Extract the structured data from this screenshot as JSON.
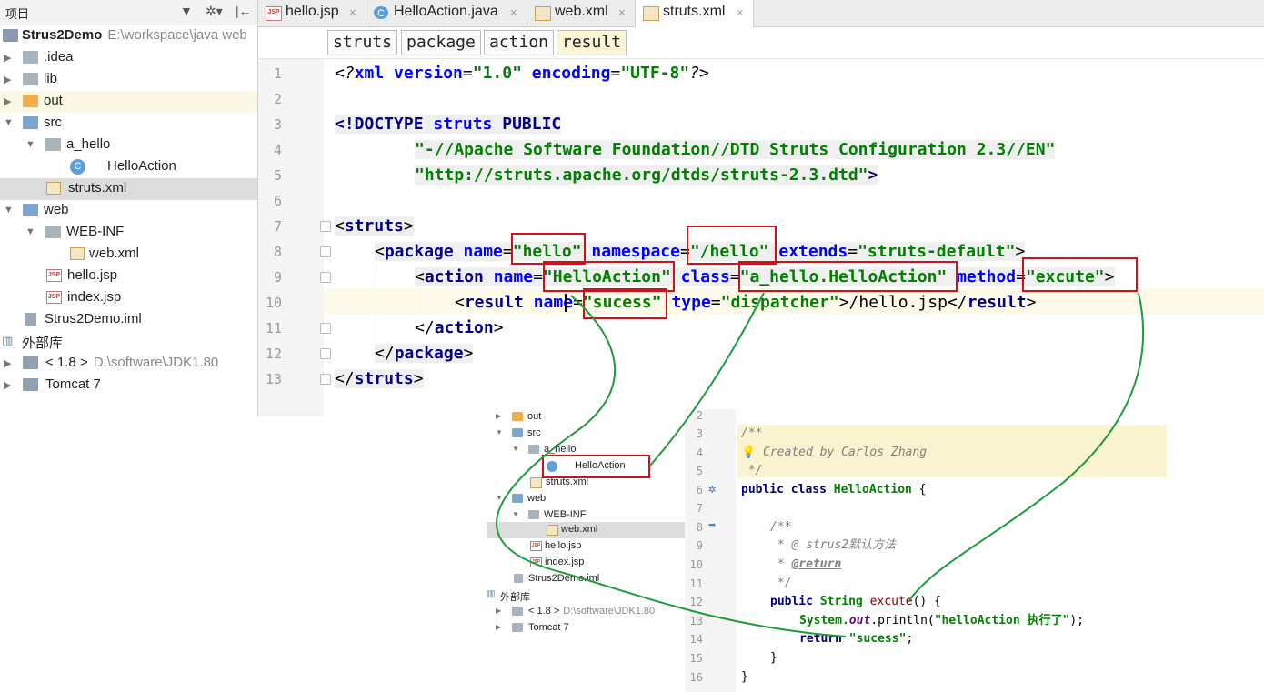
{
  "project_panel": {
    "title": "项目",
    "tree": [
      {
        "label": "Strus2Demo",
        "path": "E:\\workspace\\java web",
        "icon": "module-icon"
      },
      {
        "label": ".idea",
        "icon": "folder-icon"
      },
      {
        "label": "lib",
        "icon": "folder-icon"
      },
      {
        "label": "out",
        "icon": "folder-orange-icon"
      },
      {
        "label": "src",
        "icon": "folder-blue-icon"
      },
      {
        "label": "a_hello",
        "icon": "package-icon"
      },
      {
        "label": "HelloAction",
        "icon": "class-icon"
      },
      {
        "label": "struts.xml",
        "icon": "xml-file-icon"
      },
      {
        "label": "web",
        "icon": "web-folder-icon"
      },
      {
        "label": "WEB-INF",
        "icon": "folder-icon"
      },
      {
        "label": "web.xml",
        "icon": "xml-file-icon"
      },
      {
        "label": "hello.jsp",
        "icon": "jsp-file-icon"
      },
      {
        "label": "index.jsp",
        "icon": "jsp-file-icon"
      },
      {
        "label": "Strus2Demo.iml",
        "icon": "iml-file-icon"
      },
      {
        "label": "外部库",
        "icon": "library-icon"
      },
      {
        "label": "< 1.8 >",
        "path": "D:\\software\\JDK1.80",
        "icon": "jdk-icon"
      },
      {
        "label": "Tomcat 7",
        "icon": "tomcat-icon"
      }
    ]
  },
  "tabs": [
    {
      "label": "hello.jsp",
      "icon": "jsp-file-icon",
      "close": "×"
    },
    {
      "label": "HelloAction.java",
      "icon": "class-icon",
      "close": "×"
    },
    {
      "label": "web.xml",
      "icon": "xml-file-icon",
      "close": "×"
    },
    {
      "label": "struts.xml",
      "icon": "xml-file-icon",
      "close": "×",
      "active": true
    }
  ],
  "breadcrumb": [
    "struts",
    "package",
    "action",
    "result"
  ],
  "editor": {
    "line_numbers": [
      "1",
      "2",
      "3",
      "4",
      "5",
      "6",
      "7",
      "8",
      "9",
      "10",
      "11",
      "12",
      "13"
    ],
    "line1": {
      "p1": "<?",
      "p2": "xml version",
      "p3": "=",
      "p4": "\"1.0\"",
      "p5": " encoding",
      "p6": "=",
      "p7": "\"UTF-8\"",
      "p8": "?>"
    },
    "line3": {
      "p1": "<!DOCTYPE ",
      "p2": "struts",
      "p3": " PUBLIC"
    },
    "line4": "\"-//Apache Software Foundation//DTD Struts Configuration 2.3//EN\"",
    "line5": "\"http://struts.apache.org/dtds/struts-2.3.dtd\"",
    "line5_end": ">",
    "line7": {
      "lt": "<",
      "tag": "struts",
      "gt": ">"
    },
    "line8": {
      "lt": "<",
      "tag": "package",
      "a1": " name",
      "eq1": "=",
      "v1": "\"hello\"",
      "a2": " namespace",
      "eq2": "=",
      "v2": "\"/hello\"",
      "a3": " extends",
      "eq3": "=",
      "v3": "\"struts-default\"",
      "gt": ">"
    },
    "line9": {
      "lt": "<",
      "tag": "action",
      "a1": " name",
      "eq1": "=",
      "v1": "\"HelloAction\"",
      "a2": " class",
      "eq2": "=",
      "v2": "\"a_hello.HelloAction\"",
      "a3": " method",
      "eq3": "=",
      "v3": "\"excute\"",
      "gt": ">"
    },
    "line10": {
      "lt": "<",
      "tag": "result",
      "a1": " name",
      "eq1": "=",
      "v1": "\"sucess\"",
      "a2": " type",
      "eq2": "=",
      "v2": "\"dispatcher\"",
      "gt": ">",
      "text": "/hello.jsp",
      "clt": "</",
      "ctag": "result",
      "cgt": ">"
    },
    "line11": {
      "lt": "</",
      "tag": "action",
      "gt": ">"
    },
    "line12": {
      "lt": "</",
      "tag": "package",
      "gt": ">"
    },
    "line13": {
      "lt": "</",
      "tag": "struts",
      "gt": ">"
    }
  },
  "inset_tree": [
    {
      "label": "out"
    },
    {
      "label": "src"
    },
    {
      "label": "a_hello"
    },
    {
      "label": "HelloAction"
    },
    {
      "label": "struts.xml"
    },
    {
      "label": "web"
    },
    {
      "label": "WEB-INF"
    },
    {
      "label": "web.xml"
    },
    {
      "label": "hello.jsp"
    },
    {
      "label": "index.jsp"
    },
    {
      "label": "Strus2Demo.iml"
    },
    {
      "label": "外部库"
    },
    {
      "label": "< 1.8 >",
      "path": "D:\\software\\JDK1.80"
    },
    {
      "label": "Tomcat 7"
    }
  ],
  "inset_code": {
    "line_numbers": [
      "2",
      "3",
      "4",
      "5",
      "6",
      "7",
      "8",
      "9",
      "10",
      "11",
      "12",
      "13",
      "14",
      "15",
      "16"
    ],
    "l3": "/**",
    "l4": "Created by Carlos Zhang",
    "l5": " */",
    "l6": {
      "kw": "public class ",
      "name": "HelloAction",
      "rest": " {"
    },
    "l8": "/**",
    "l9": " * @ strus2默认方法",
    "l10a": " * ",
    "l10b": "@return",
    "l11": " */",
    "l12": {
      "kw": "public ",
      "type": "String ",
      "name": "excute",
      "rest": "() {"
    },
    "l13": {
      "cls": "System.",
      "fld": "out",
      "mid": ".println(",
      "str": "\"helloAction 执行了\"",
      "end": ");"
    },
    "l14": {
      "kw": "return ",
      "str": "\"sucess\"",
      "end": ";"
    },
    "l15": "}",
    "l16": "}"
  },
  "colors": {
    "annotation_box": "#d0101a",
    "annotation_line": "#1f9a3b"
  }
}
